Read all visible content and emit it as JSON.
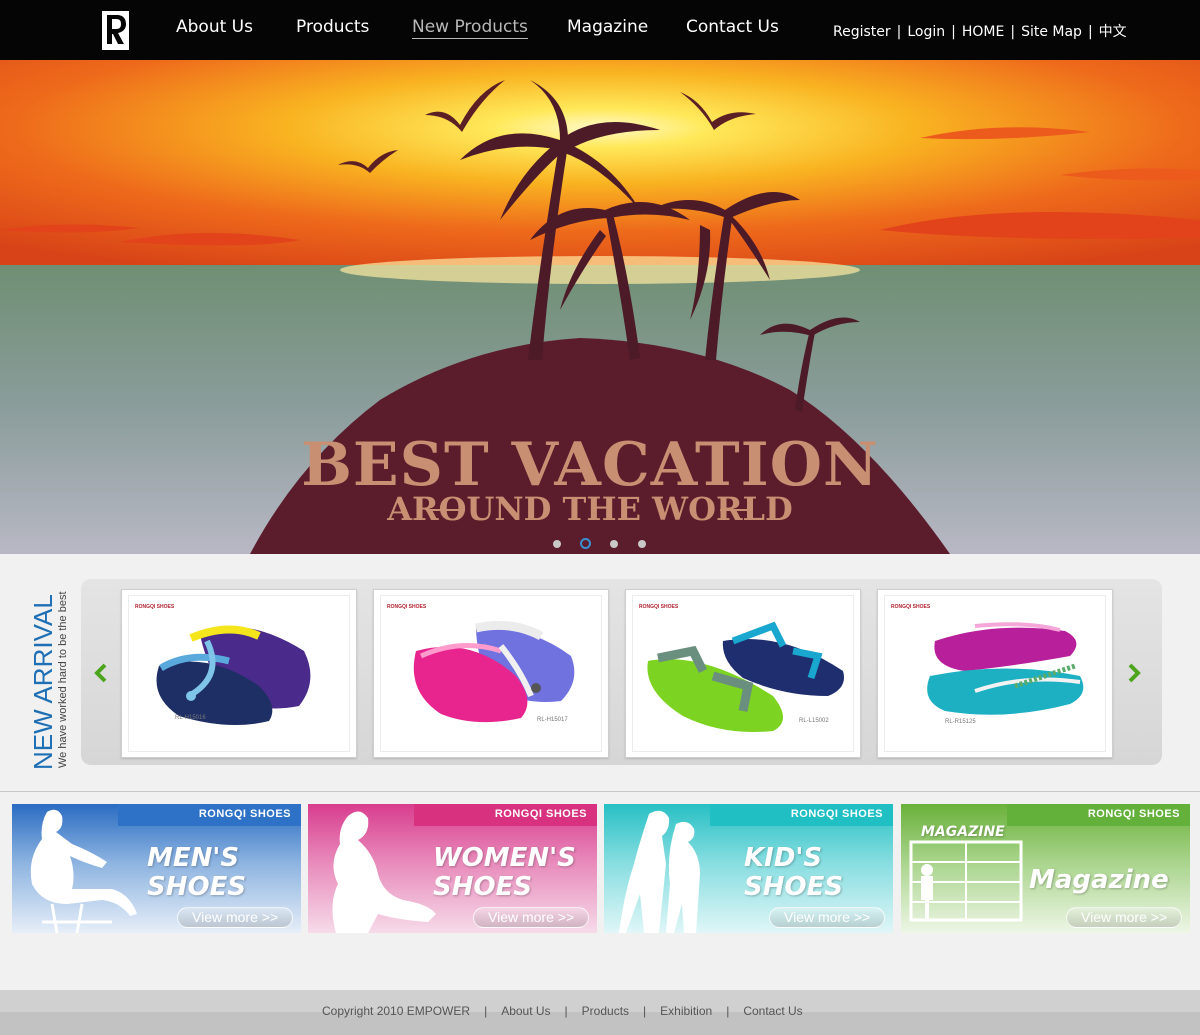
{
  "header": {
    "logo_letter": "R",
    "nav": [
      {
        "label": "About Us"
      },
      {
        "label": "Products"
      },
      {
        "label": "New Products"
      },
      {
        "label": "Magazine"
      },
      {
        "label": "Contact Us"
      }
    ],
    "toplinks": [
      "Register",
      "Login",
      "HOME",
      "Site Map",
      "中文"
    ],
    "separator": "|"
  },
  "banner": {
    "headline": "BEST VACATION",
    "subline": "AROUND THE WORLD",
    "slide_count": 4,
    "active_slide": 2
  },
  "new_arrival": {
    "title": "NEW ARRIVAL",
    "tagline": "We have worked hard to be the best",
    "cards": [
      {
        "brand": "RONGQI SHOES",
        "code": "RL-H15016"
      },
      {
        "brand": "RONGQI SHOES",
        "code": "RL-H15017"
      },
      {
        "brand": "RONGQI SHOES",
        "code": "RL-L15002"
      },
      {
        "brand": "RONGQI SHOES",
        "code": "RL-R15125"
      }
    ]
  },
  "categories": [
    {
      "brand": "RONGQI SHOES",
      "line1": "MEN'S",
      "line2": "SHOES",
      "cta": "View more  >>"
    },
    {
      "brand": "RONGQI SHOES",
      "line1": "WOMEN'S",
      "line2": "SHOES",
      "cta": "View more  >>"
    },
    {
      "brand": "RONGQI SHOES",
      "line1": "KID'S",
      "line2": "SHOES",
      "cta": "View more  >>"
    },
    {
      "brand": "RONGQI SHOES",
      "label_top": "MAGAZINE",
      "line1": "Magazine",
      "cta": "View more  >>"
    }
  ],
  "footer": {
    "copyright": "Copyright 2010 EMPOWER",
    "links": [
      "About Us",
      "Products",
      "Exhibition",
      "Contact Us"
    ],
    "separator": "|"
  },
  "colors": {
    "header_bg": "#050505",
    "accent_blue": "#1f6fb5",
    "arrow_green": "#4ca51c",
    "men": "#2a6cc2",
    "women": "#d83d8e",
    "kids": "#27c0c4",
    "magazine": "#6ab13a"
  }
}
